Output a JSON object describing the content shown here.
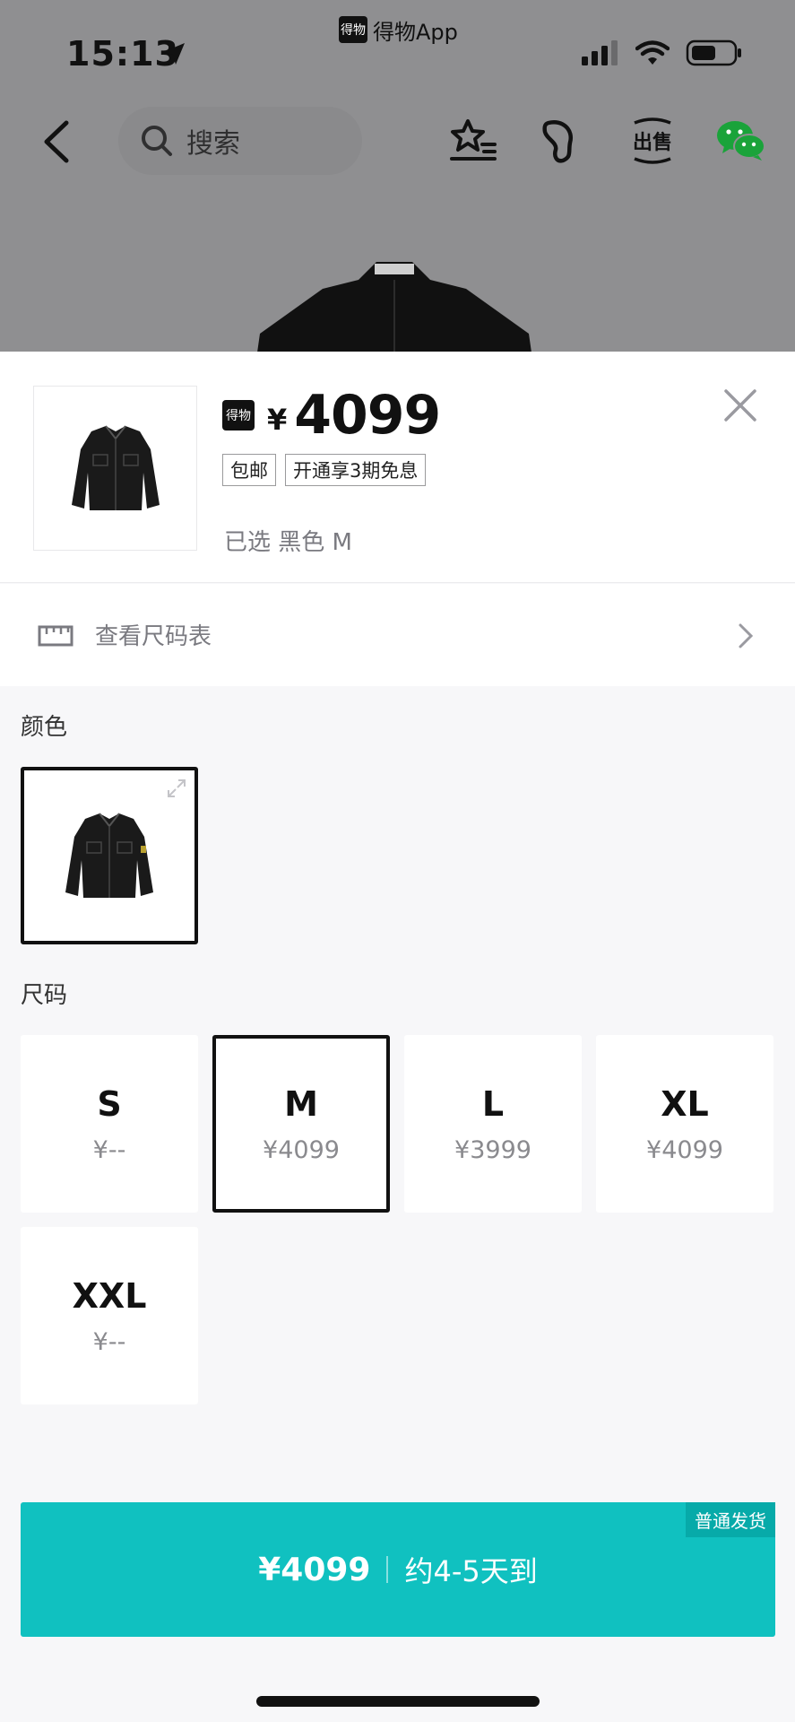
{
  "status_bar": {
    "time": "15:13",
    "app_name": "得物App",
    "app_logo_text": "得物"
  },
  "nav": {
    "search_placeholder": "搜索",
    "sell_label": "出售"
  },
  "sheet": {
    "logo_text": "得物",
    "currency": "¥",
    "price": "4099",
    "tags": [
      "包邮",
      "开通享3期免息"
    ],
    "selected_label": "已选 黑色 M",
    "size_chart_label": "查看尺码表",
    "color_section_title": "颜色",
    "size_section_title": "尺码",
    "sizes": [
      {
        "size": "S",
        "price": "¥--",
        "selected": false
      },
      {
        "size": "M",
        "price": "¥4099",
        "selected": true
      },
      {
        "size": "L",
        "price": "¥3999",
        "selected": false
      },
      {
        "size": "XL",
        "price": "¥4099",
        "selected": false
      },
      {
        "size": "XXL",
        "price": "¥--",
        "selected": false
      }
    ]
  },
  "buy_button": {
    "price": "¥4099",
    "eta": "约4-5天到",
    "badge": "普通发货"
  },
  "colors": {
    "accent": "#10c1c0",
    "accent_dark": "#07aaa9",
    "text": "#111111",
    "muted": "#7a7a80"
  }
}
